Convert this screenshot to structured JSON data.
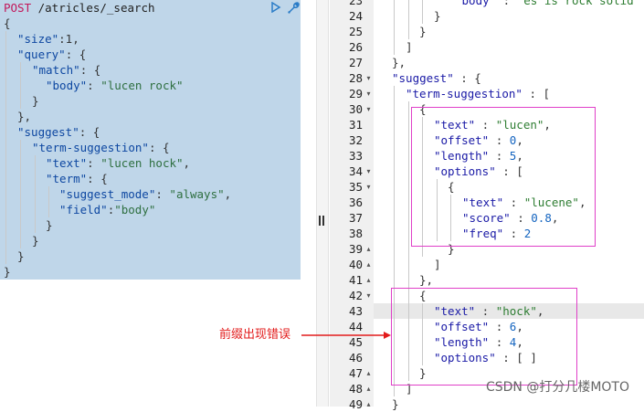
{
  "request": {
    "method": "POST",
    "path": " /atricles/_search",
    "lines": {
      "l2": "{",
      "l3_key": "\"size\"",
      "l3_rest": ":1,",
      "l4_key": "\"query\"",
      "l4_rest": ": {",
      "l5_key": "\"match\"",
      "l5_rest": ": {",
      "l6_key": "\"body\"",
      "l6_sep": ": ",
      "l6_val": "\"lucen rock\"",
      "l7": "}",
      "l8": "},",
      "l9_key": "\"suggest\"",
      "l9_rest": ": {",
      "l10_key": "\"term-suggestion\"",
      "l10_rest": ": {",
      "l11_key": "\"text\"",
      "l11_sep": ": ",
      "l11_val": "\"lucen hock\"",
      "l11_end": ",",
      "l12_key": "\"term\"",
      "l12_rest": ": {",
      "l13_key": "\"suggest_mode\"",
      "l13_sep": ": ",
      "l13_val": "\"always\"",
      "l13_end": ",",
      "l14_key": "\"field\"",
      "l14_sep": ":",
      "l14_val": "\"body\"",
      "l15": "}",
      "l16": "}",
      "l17": "}",
      "l18": "}"
    }
  },
  "response": {
    "line_numbers": [
      "23",
      "24",
      "25",
      "26",
      "27",
      "28",
      "29",
      "30",
      "31",
      "32",
      "33",
      "34",
      "35",
      "36",
      "37",
      "38",
      "39",
      "40",
      "41",
      "42",
      "43",
      "44",
      "45",
      "46",
      "47",
      "48",
      "49"
    ],
    "lines": {
      "r23_key": "\"body\"",
      "r23_sep": " : ",
      "r23_val": "\"es is rock solid\"",
      "r24": "}",
      "r25": "}",
      "r26": "]",
      "r27": "},",
      "r28_key": "\"suggest\"",
      "r28_rest": " : {",
      "r29_key": "\"term-suggestion\"",
      "r29_rest": " : [",
      "r30": "{",
      "r31_key": "\"text\"",
      "r31_sep": " : ",
      "r31_val": "\"lucen\"",
      "r31_end": ",",
      "r32_key": "\"offset\"",
      "r32_sep": " : ",
      "r32_val": "0",
      "r32_end": ",",
      "r33_key": "\"length\"",
      "r33_sep": " : ",
      "r33_val": "5",
      "r33_end": ",",
      "r34_key": "\"options\"",
      "r34_rest": " : [",
      "r35": "{",
      "r36_key": "\"text\"",
      "r36_sep": " : ",
      "r36_val": "\"lucene\"",
      "r36_end": ",",
      "r37_key": "\"score\"",
      "r37_sep": " : ",
      "r37_val": "0.8",
      "r37_end": ",",
      "r38_key": "\"freq\"",
      "r38_sep": " : ",
      "r38_val": "2",
      "r39": "}",
      "r40": "]",
      "r41": "},",
      "r42": "{",
      "r43_key": "\"text\"",
      "r43_sep": " : ",
      "r43_val": "\"hock\"",
      "r43_end": ",",
      "r44_key": "\"offset\"",
      "r44_sep": " : ",
      "r44_val": "6",
      "r44_end": ",",
      "r45_key": "\"length\"",
      "r45_sep": " : ",
      "r45_val": "4",
      "r45_end": ",",
      "r46_key": "\"options\"",
      "r46_rest": " : [ ]",
      "r47": "}",
      "r48": "]",
      "r49": "}"
    }
  },
  "annotation": {
    "label": "前缀出现错误"
  },
  "watermark": "CSDN @打分几楼MOTO",
  "icons": {
    "run": "play-icon",
    "settings": "wrench-icon",
    "divider": "resize-handle-icon"
  },
  "colors": {
    "request_bg": "#bfd6e9",
    "method": "#c2185b",
    "callout": "#e040c8",
    "annotation": "#e21b1b"
  }
}
